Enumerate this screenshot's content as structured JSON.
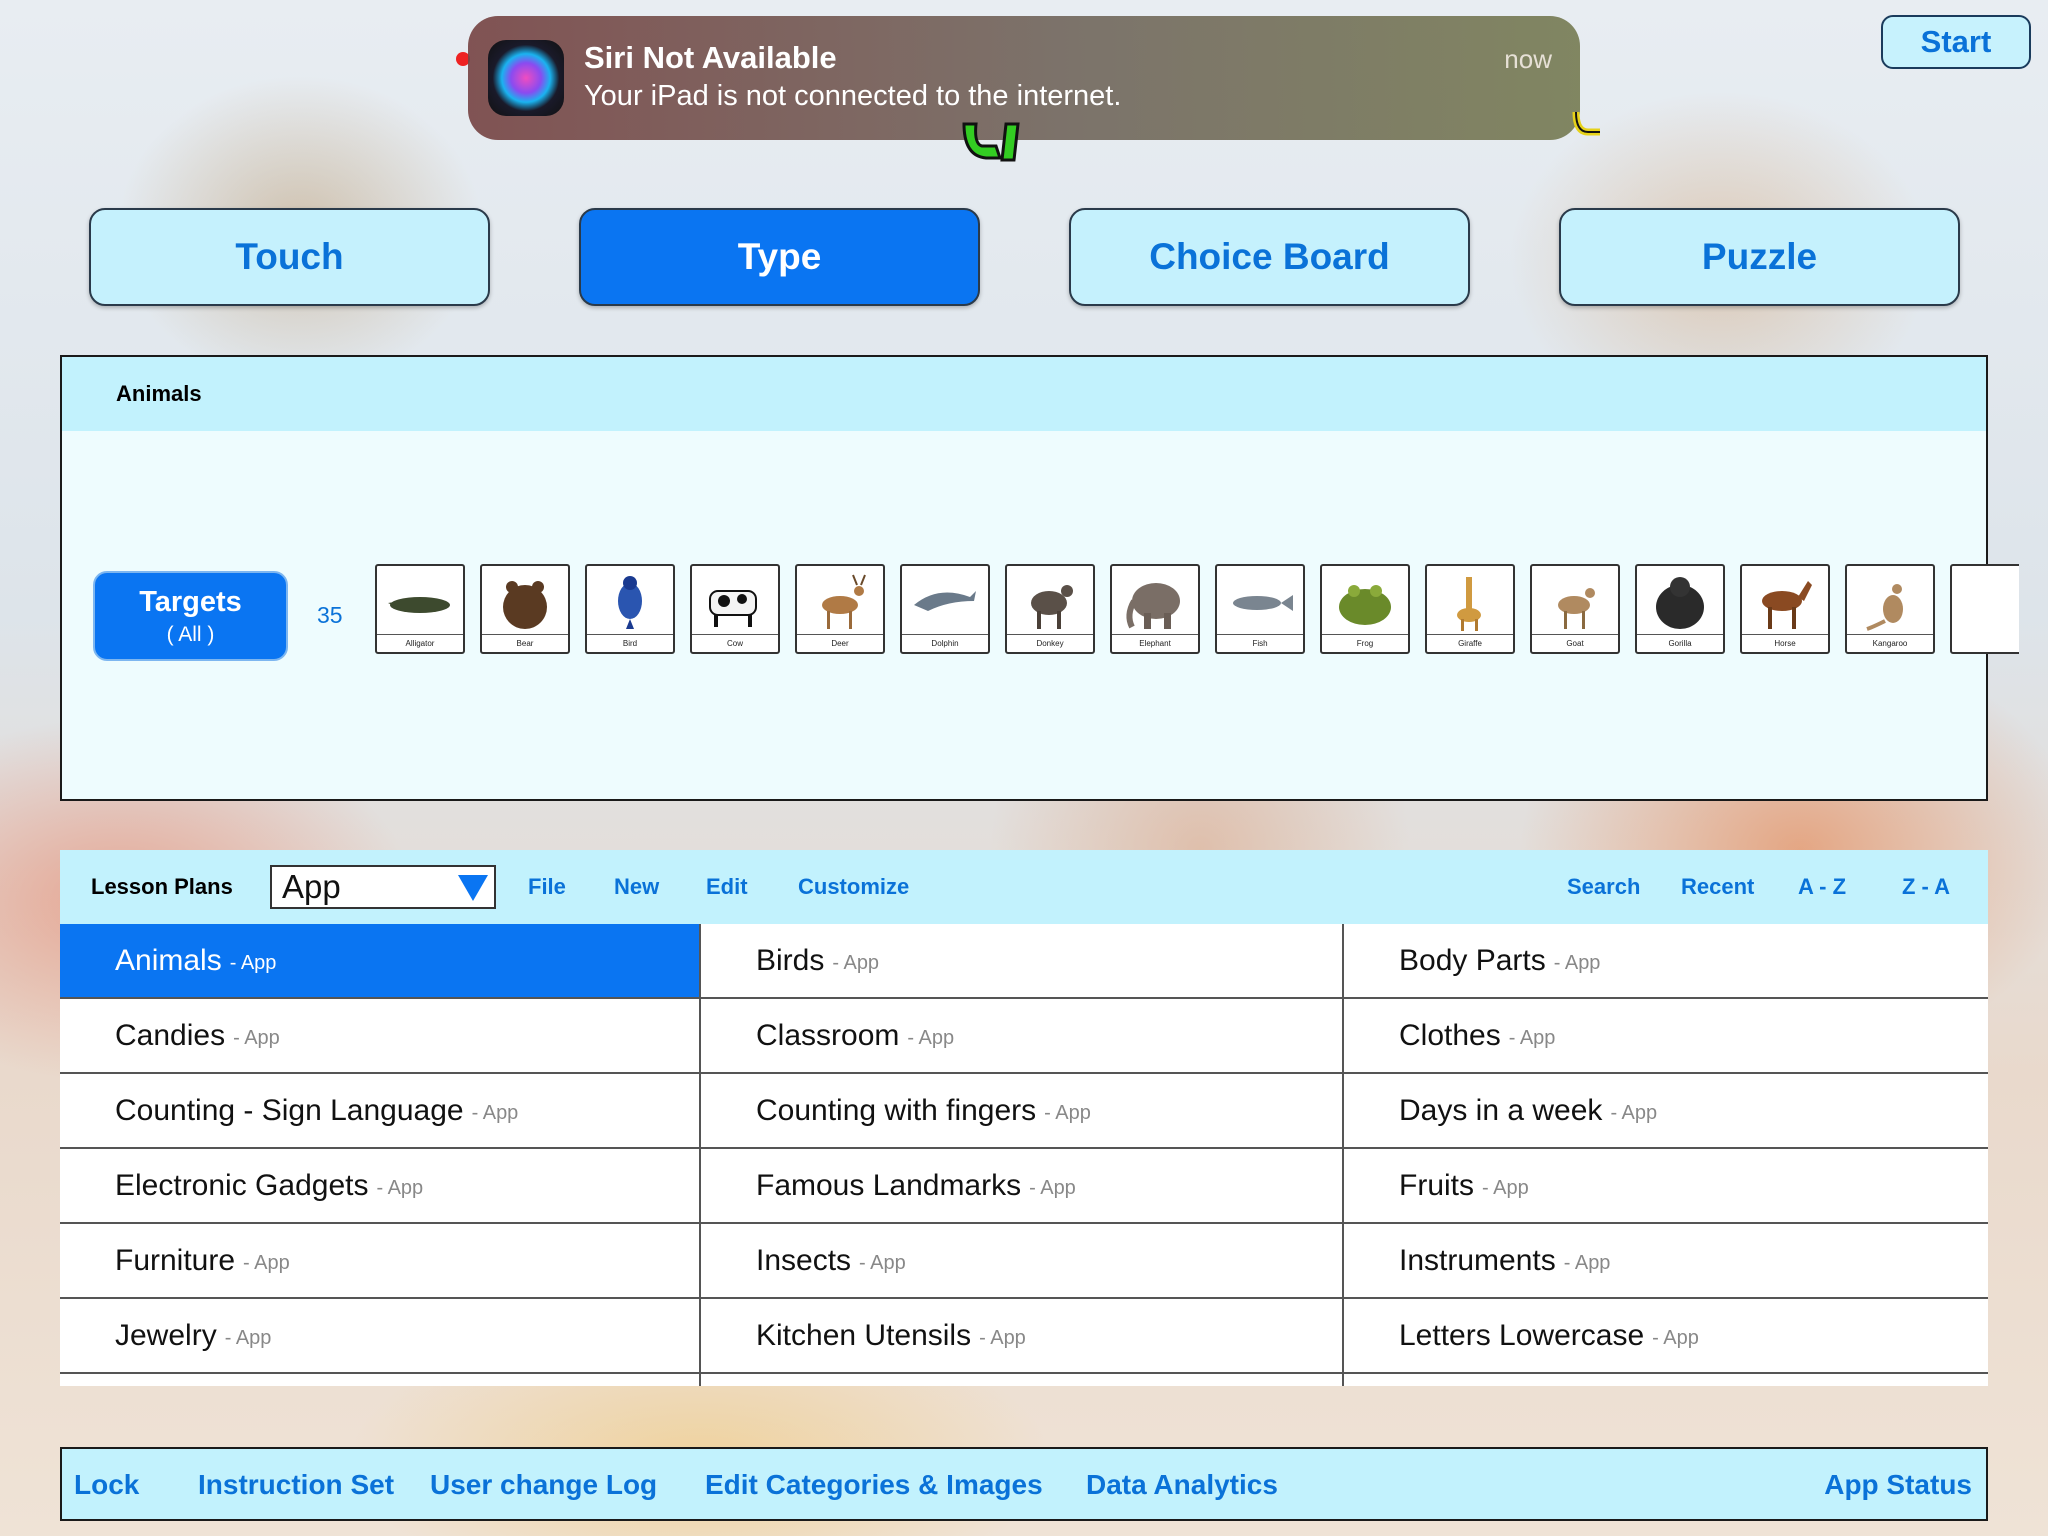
{
  "notification": {
    "title": "Siri Not Available",
    "body": "Your iPad is not connected to the internet.",
    "time": "now"
  },
  "start_label": "Start",
  "modes": [
    {
      "label": "Touch",
      "active": false
    },
    {
      "label": "Type",
      "active": true
    },
    {
      "label": "Choice Board",
      "active": false
    },
    {
      "label": "Puzzle",
      "active": false
    }
  ],
  "targets": {
    "header": "Animals",
    "button_label": "Targets",
    "button_sub": "( All )",
    "count": "35",
    "cards": [
      {
        "label": "Alligator",
        "icon": "alligator-icon"
      },
      {
        "label": "Bear",
        "icon": "bear-icon"
      },
      {
        "label": "Bird",
        "icon": "bird-icon"
      },
      {
        "label": "Cow",
        "icon": "cow-icon"
      },
      {
        "label": "Deer",
        "icon": "deer-icon"
      },
      {
        "label": "Dolphin",
        "icon": "dolphin-icon"
      },
      {
        "label": "Donkey",
        "icon": "donkey-icon"
      },
      {
        "label": "Elephant",
        "icon": "elephant-icon"
      },
      {
        "label": "Fish",
        "icon": "fish-icon"
      },
      {
        "label": "Frog",
        "icon": "frog-icon"
      },
      {
        "label": "Giraffe",
        "icon": "giraffe-icon"
      },
      {
        "label": "Goat",
        "icon": "goat-icon"
      },
      {
        "label": "Gorilla",
        "icon": "gorilla-icon"
      },
      {
        "label": "Horse",
        "icon": "horse-icon"
      },
      {
        "label": "Kangaroo",
        "icon": "kangaroo-icon"
      },
      {
        "label": "",
        "icon": "partial-card"
      }
    ]
  },
  "lesson_plans": {
    "title": "Lesson Plans",
    "select_value": "App",
    "actions": [
      "File",
      "New",
      "Edit",
      "Customize"
    ],
    "sort": [
      "Search",
      "Recent",
      "A - Z",
      "Z - A"
    ],
    "items": [
      {
        "name": "Animals",
        "suffix": "- App",
        "selected": true
      },
      {
        "name": "Birds",
        "suffix": "- App"
      },
      {
        "name": "Body Parts",
        "suffix": "- App"
      },
      {
        "name": "Candies",
        "suffix": "- App"
      },
      {
        "name": "Classroom",
        "suffix": "- App"
      },
      {
        "name": "Clothes",
        "suffix": "- App"
      },
      {
        "name": "Counting - Sign Language",
        "suffix": "- App"
      },
      {
        "name": "Counting with fingers",
        "suffix": "- App"
      },
      {
        "name": "Days in a week",
        "suffix": "- App"
      },
      {
        "name": "Electronic Gadgets",
        "suffix": "- App"
      },
      {
        "name": "Famous Landmarks",
        "suffix": "- App"
      },
      {
        "name": "Fruits",
        "suffix": "- App"
      },
      {
        "name": "Furniture",
        "suffix": "- App"
      },
      {
        "name": "Insects",
        "suffix": "- App"
      },
      {
        "name": "Instruments",
        "suffix": "- App"
      },
      {
        "name": "Jewelry",
        "suffix": "- App"
      },
      {
        "name": "Kitchen Utensils",
        "suffix": "- App"
      },
      {
        "name": "Letters Lowercase",
        "suffix": "- App"
      },
      {
        "name": "",
        "suffix": ""
      },
      {
        "name": "",
        "suffix": ""
      },
      {
        "name": "",
        "suffix": ""
      }
    ]
  },
  "bottom_bar": {
    "lock": "Lock",
    "instruction_set": "Instruction Set",
    "user_change_log": "User change Log",
    "edit_categories": "Edit Categories & Images",
    "data_analytics": "Data Analytics",
    "app_status": "App Status"
  },
  "colors": {
    "accent": "#0a75f2",
    "panel": "#c2f2fd",
    "link": "#0a72d8"
  }
}
